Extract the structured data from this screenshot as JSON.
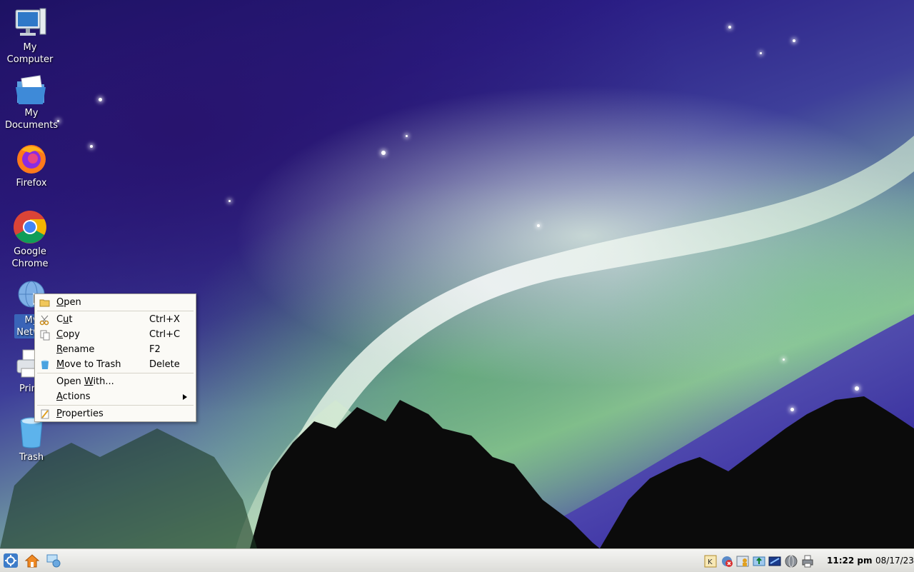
{
  "desktop_icons": [
    {
      "name": "My\nComputer",
      "line1": "My",
      "line2": "Computer",
      "icon": "computer-icon"
    },
    {
      "name": "My\nDocuments",
      "line1": "My",
      "line2": "Documents",
      "icon": "folder-icon"
    },
    {
      "line1": "Firefox",
      "line2": "",
      "icon": "firefox-icon"
    },
    {
      "line1": "Google",
      "line2": "Chrome",
      "icon": "chrome-icon"
    },
    {
      "line1": "My",
      "line2": "Netwo",
      "icon": "network-globe-icon"
    },
    {
      "line1": "Print",
      "line2": "",
      "icon": "printer-icon"
    },
    {
      "line1": "Trash",
      "line2": "",
      "icon": "trash-icon"
    }
  ],
  "context_menu": {
    "open": "Open",
    "cut": {
      "label": "Cut",
      "shortcut": "Ctrl+X"
    },
    "copy": {
      "label": "Copy",
      "shortcut": "Ctrl+C"
    },
    "rename": {
      "label": "Rename",
      "shortcut": "F2"
    },
    "move_to_trash": {
      "label": "Move to Trash",
      "shortcut": "Delete"
    },
    "open_with": "Open With...",
    "actions": "Actions",
    "properties": "Properties"
  },
  "taskbar": {
    "buttons": [
      "kde-menu-icon",
      "home-icon",
      "network-icon"
    ],
    "tray": [
      "k-icon",
      "network-error-icon",
      "user-icon",
      "update-icon",
      "display-icon",
      "globe-icon",
      "printer-tray-icon"
    ],
    "clock_time": "11:22 pm",
    "clock_date": "08/17/23"
  },
  "colors": {
    "menu_bg": "#fbfaf6",
    "selection": "#3c78c8"
  }
}
